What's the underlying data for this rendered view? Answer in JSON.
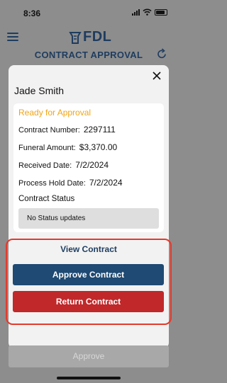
{
  "status_bar": {
    "time": "8:36"
  },
  "header": {
    "logo_text": "FDL",
    "title": "CONTRACT APPROVAL"
  },
  "modal": {
    "client_name": "Jade Smith",
    "status": "Ready for Approval",
    "fields": [
      {
        "label": "Contract Number:",
        "value": "2297111"
      },
      {
        "label": "Funeral Amount:",
        "value": "$3,370.00"
      },
      {
        "label": "Received Date:",
        "value": "7/2/2024"
      },
      {
        "label": "Process Hold Date:",
        "value": "7/2/2024"
      }
    ],
    "contract_status_label": "Contract Status",
    "no_status_text": "No Status updates",
    "view_contract_label": "View Contract",
    "approve_contract_label": "Approve Contract",
    "return_contract_label": "Return Contract"
  },
  "footer": {
    "approve_label": "Approve"
  },
  "colors": {
    "brand_navy": "#1e3c5f",
    "status_orange": "#f0a417",
    "approve_blue": "#1e4a73",
    "return_red": "#c0282a",
    "highlight_red": "#e33a2b"
  },
  "icons": [
    "signal-icon",
    "wifi-icon",
    "battery-icon",
    "menu-icon",
    "fdl-logo",
    "refresh-icon",
    "close-icon"
  ]
}
